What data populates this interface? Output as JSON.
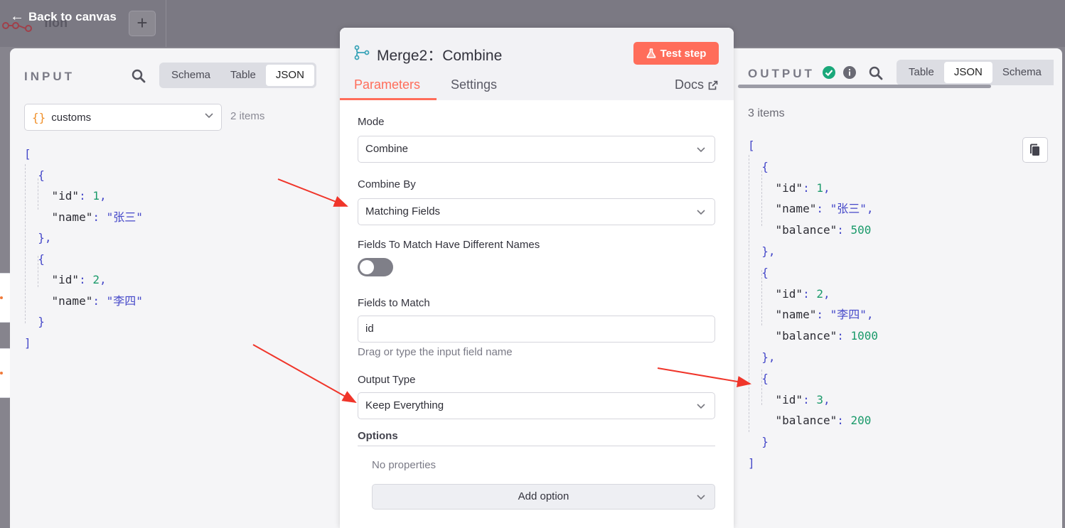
{
  "canvas": {
    "back_label": "Back to canvas",
    "workflow_name": "flon",
    "add_icon": "plus-icon"
  },
  "input": {
    "title": "INPUT",
    "view_tabs": [
      "Schema",
      "Table",
      "JSON"
    ],
    "active_view": "JSON",
    "node_name": "customs",
    "items_count": "2 items",
    "json": [
      {
        "id": "1",
        "name": "\"张三\""
      },
      {
        "id": "2",
        "name": "\"李四\""
      }
    ]
  },
  "modal": {
    "title": "Merge2：Combine",
    "test_button": "Test step",
    "tabs": [
      "Parameters",
      "Settings"
    ],
    "active_tab": "Parameters",
    "docs_label": "Docs",
    "mode": {
      "label": "Mode",
      "value": "Combine"
    },
    "combine_by": {
      "label": "Combine By",
      "value": "Matching Fields"
    },
    "different_names": {
      "label": "Fields To Match Have Different Names",
      "enabled": false
    },
    "fields_to_match": {
      "label": "Fields to Match",
      "value": "id",
      "hint": "Drag or type the input field name"
    },
    "output_type": {
      "label": "Output Type",
      "value": "Keep Everything"
    },
    "options": {
      "label": "Options",
      "empty_text": "No properties",
      "add_label": "Add option"
    }
  },
  "output": {
    "title": "OUTPUT",
    "view_tabs": [
      "Table",
      "JSON",
      "Schema"
    ],
    "active_view": "JSON",
    "items_count": "3 items",
    "json": [
      {
        "id": "1",
        "name": "\"张三\"",
        "balance": "500"
      },
      {
        "id": "2",
        "name": "\"李四\"",
        "balance": "1000"
      },
      {
        "id": "3",
        "balance": "200"
      }
    ]
  },
  "colors": {
    "accent": "#ff6d5a",
    "success": "#1aa87a",
    "annotation_arrow": "#f0352a"
  }
}
